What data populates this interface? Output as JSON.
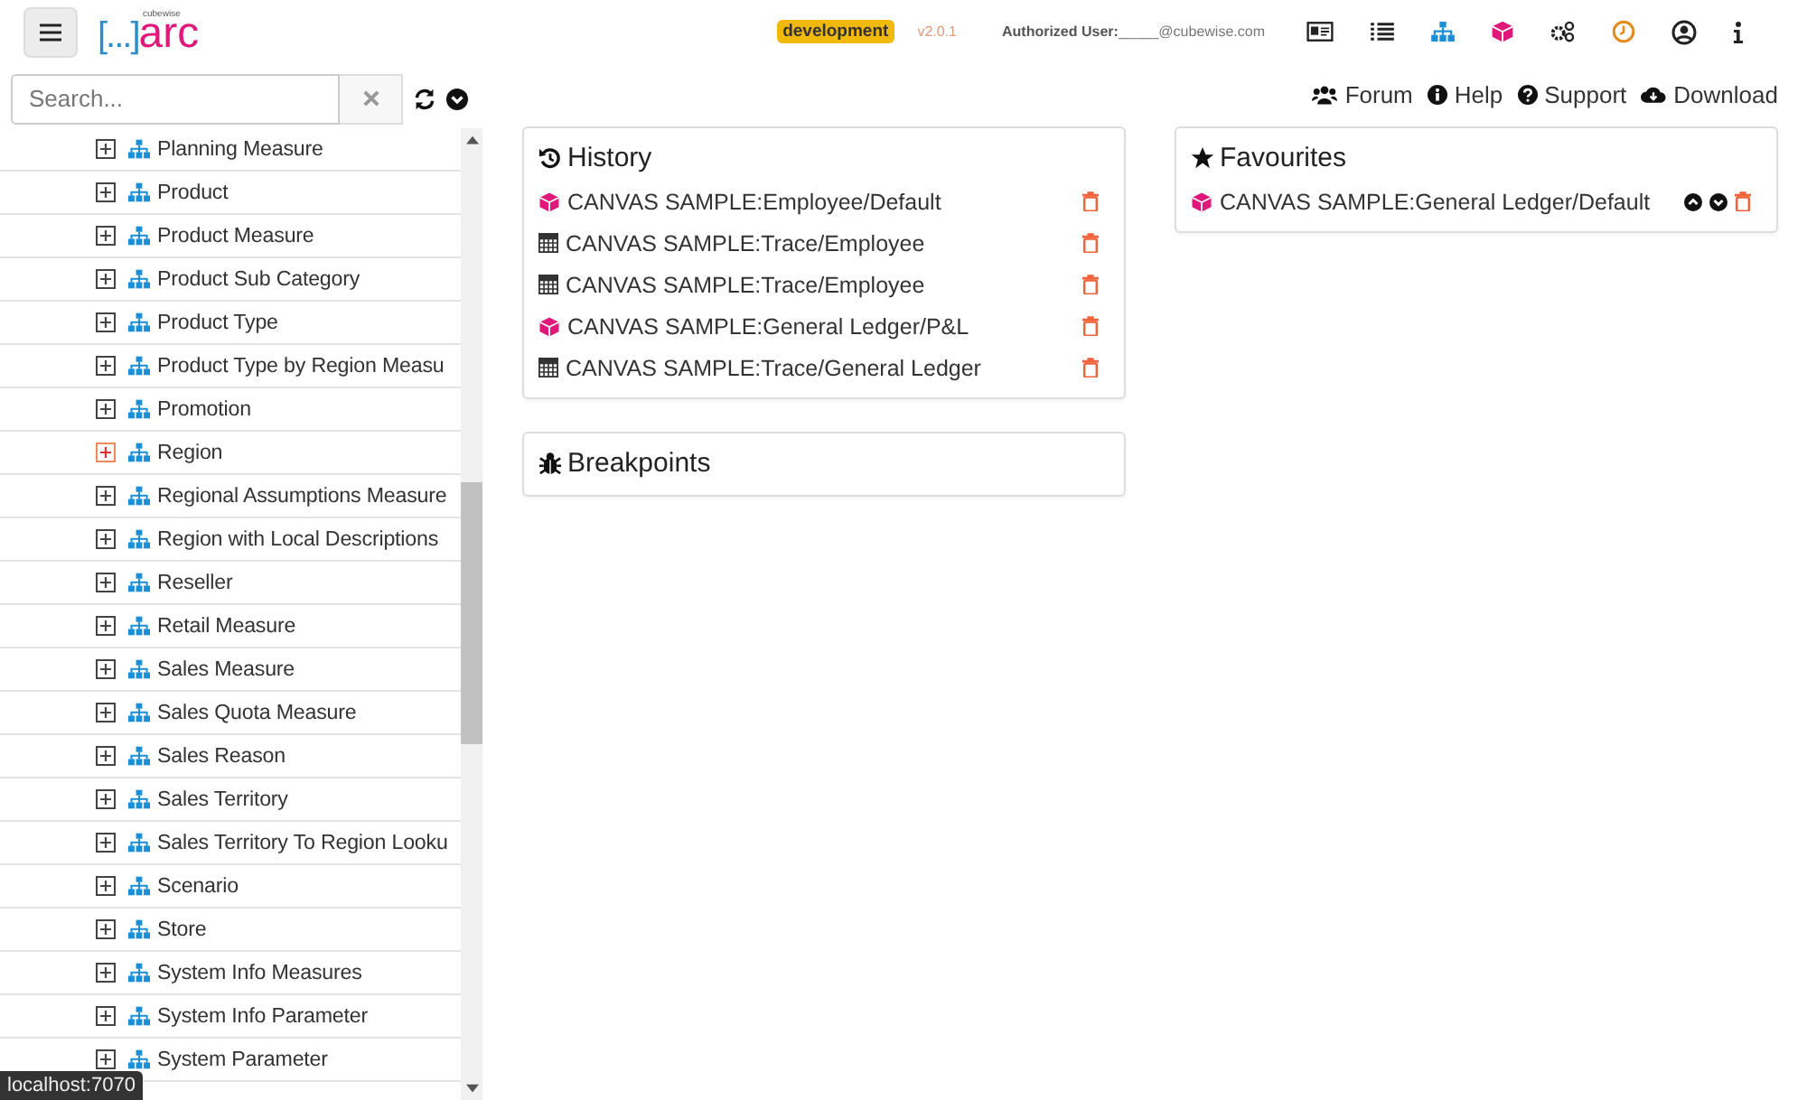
{
  "header": {
    "logo": {
      "brackets": "[...]",
      "name": "arc",
      "maker": "cubewise"
    },
    "environment": "development",
    "version": "v2.0.1",
    "user_label": "Authorized User:",
    "user_email": "_____@cubewise.com"
  },
  "search": {
    "placeholder": "Search..."
  },
  "links": [
    {
      "kind": "forum",
      "label": "Forum"
    },
    {
      "kind": "help",
      "label": "Help"
    },
    {
      "kind": "support",
      "label": "Support"
    },
    {
      "kind": "download",
      "label": "Download"
    }
  ],
  "tree": [
    {
      "label": "Planning Measure",
      "hovered": false
    },
    {
      "label": "Product",
      "hovered": false
    },
    {
      "label": "Product Measure",
      "hovered": false
    },
    {
      "label": "Product Sub Category",
      "hovered": false
    },
    {
      "label": "Product Type",
      "hovered": false
    },
    {
      "label": "Product Type by Region Measu",
      "hovered": false
    },
    {
      "label": "Promotion",
      "hovered": false
    },
    {
      "label": "Region",
      "hovered": true
    },
    {
      "label": "Regional Assumptions Measure",
      "hovered": false
    },
    {
      "label": "Region with Local Descriptions",
      "hovered": false
    },
    {
      "label": "Reseller",
      "hovered": false
    },
    {
      "label": "Retail Measure",
      "hovered": false
    },
    {
      "label": "Sales Measure",
      "hovered": false
    },
    {
      "label": "Sales Quota Measure",
      "hovered": false
    },
    {
      "label": "Sales Reason",
      "hovered": false
    },
    {
      "label": "Sales Territory",
      "hovered": false
    },
    {
      "label": "Sales Territory To Region Looku",
      "hovered": false
    },
    {
      "label": "Scenario",
      "hovered": false
    },
    {
      "label": "Store",
      "hovered": false
    },
    {
      "label": "System Info Measures",
      "hovered": false
    },
    {
      "label": "System Info Parameter",
      "hovered": false
    },
    {
      "label": "System Parameter",
      "hovered": false
    }
  ],
  "history": {
    "title": "History",
    "items": [
      {
        "kind": "cube",
        "label": "CANVAS SAMPLE:Employee/Default"
      },
      {
        "kind": "view",
        "label": "CANVAS SAMPLE:Trace/Employee"
      },
      {
        "kind": "view",
        "label": "CANVAS SAMPLE:Trace/Employee"
      },
      {
        "kind": "cube",
        "label": "CANVAS SAMPLE:General Ledger/P&L"
      },
      {
        "kind": "view",
        "label": "CANVAS SAMPLE:Trace/General Ledger"
      }
    ]
  },
  "breakpoints": {
    "title": "Breakpoints"
  },
  "favourites": {
    "title": "Favourites",
    "items": [
      {
        "kind": "cube",
        "label": "CANVAS SAMPLE:General Ledger/Default"
      }
    ]
  },
  "status_bar": {
    "url": "localhost:7070"
  }
}
